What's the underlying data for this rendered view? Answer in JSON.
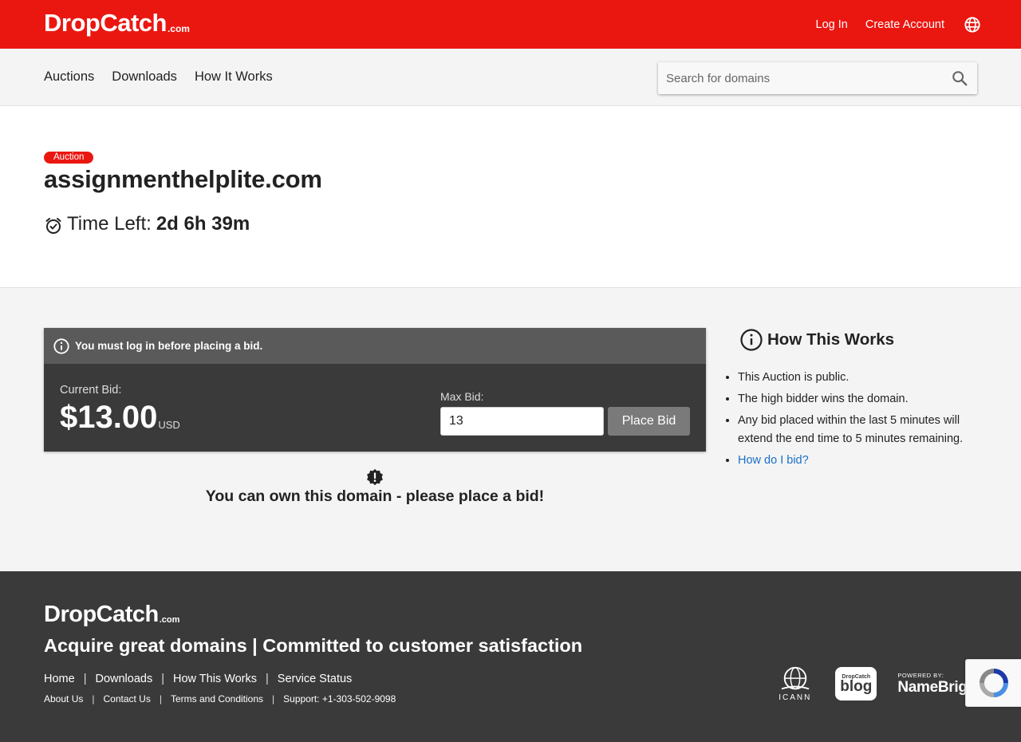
{
  "header": {
    "logo_main": "DropCatch",
    "logo_suffix": ".com",
    "login_label": "Log In",
    "create_account_label": "Create Account",
    "accent_color": "#ea1710"
  },
  "nav": {
    "items": [
      "Auctions",
      "Downloads",
      "How It Works"
    ],
    "search_placeholder": "Search for domains"
  },
  "auction": {
    "badge": "Auction",
    "domain": "assignmenthelplite.com",
    "time_left_label": "Time Left:",
    "time_left_value": "2d 6h 39m"
  },
  "bid": {
    "alert": "You must log in before placing a bid.",
    "current_bid_label": "Current Bid:",
    "current_bid_amount": "$13.00",
    "currency": "USD",
    "max_bid_label": "Max Bid:",
    "max_bid_value": "13",
    "place_bid_label": "Place Bid",
    "own_message": "You can own this domain - please place a bid!"
  },
  "how_it_works": {
    "title": "How This Works",
    "items": [
      "This Auction is public.",
      "The high bidder wins the domain.",
      "Any bid placed within the last 5 minutes will extend the end time to 5 minutes remaining."
    ],
    "link": "How do I bid?"
  },
  "footer": {
    "logo_main": "DropCatch",
    "logo_suffix": ".com",
    "tagline": "Acquire great domains | Committed to customer satisfaction",
    "links_primary": [
      "Home",
      "Downloads",
      "How This Works",
      "Service Status"
    ],
    "links_secondary": [
      "About Us",
      "Contact Us",
      "Terms and Conditions",
      "Support: +1-303-502-9098"
    ],
    "icann_label": "ICANN",
    "blog_small": "DropCatch",
    "blog_big": "blog",
    "powered_by": "POWERED BY:",
    "namebright": "NameBright"
  }
}
